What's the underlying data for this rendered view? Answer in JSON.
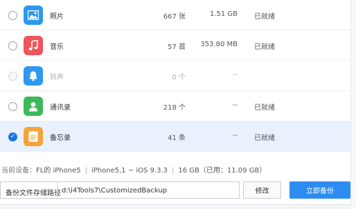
{
  "items": [
    {
      "name": "照片",
      "count": "667 张",
      "size": "1.51 GB",
      "status": "已就绪",
      "icon": "photos-icon",
      "color": "#2c98f0",
      "selected": false,
      "disabled": false
    },
    {
      "name": "音乐",
      "count": "57 首",
      "size": "353.80 MB",
      "status": "已就绪",
      "icon": "music-icon",
      "color": "#f0545c",
      "selected": false,
      "disabled": false
    },
    {
      "name": "铃声",
      "count": "0 个",
      "size": "--",
      "status": "",
      "icon": "bell-icon",
      "color": "#2c98f0",
      "selected": false,
      "disabled": true
    },
    {
      "name": "通讯录",
      "count": "218 个",
      "size": "--",
      "status": "已就绪",
      "icon": "contacts-icon",
      "color": "#3cb95a",
      "selected": false,
      "disabled": false
    },
    {
      "name": "备忘录",
      "count": "41 条",
      "size": "--",
      "status": "已就绪",
      "icon": "notes-icon",
      "color": "#f4a43a",
      "selected": true,
      "disabled": false
    }
  ],
  "device": {
    "label": "当前设备：",
    "name": "FL的 iPhone5",
    "model": "iPhone5,1 ~ iOS 9.3.3",
    "storage": "16 GB（已用：11.09 GB）",
    "separator": "|"
  },
  "path": {
    "label": "备份文件存储路径",
    "value": "d:\\i4Tools7\\CustomizedBackup"
  },
  "buttons": {
    "edit": "修改",
    "backup": "立即备份"
  },
  "check_mark": "✓",
  "colors": {
    "accent": "#2d8cf0",
    "selected_row": "#e8f1fd"
  }
}
